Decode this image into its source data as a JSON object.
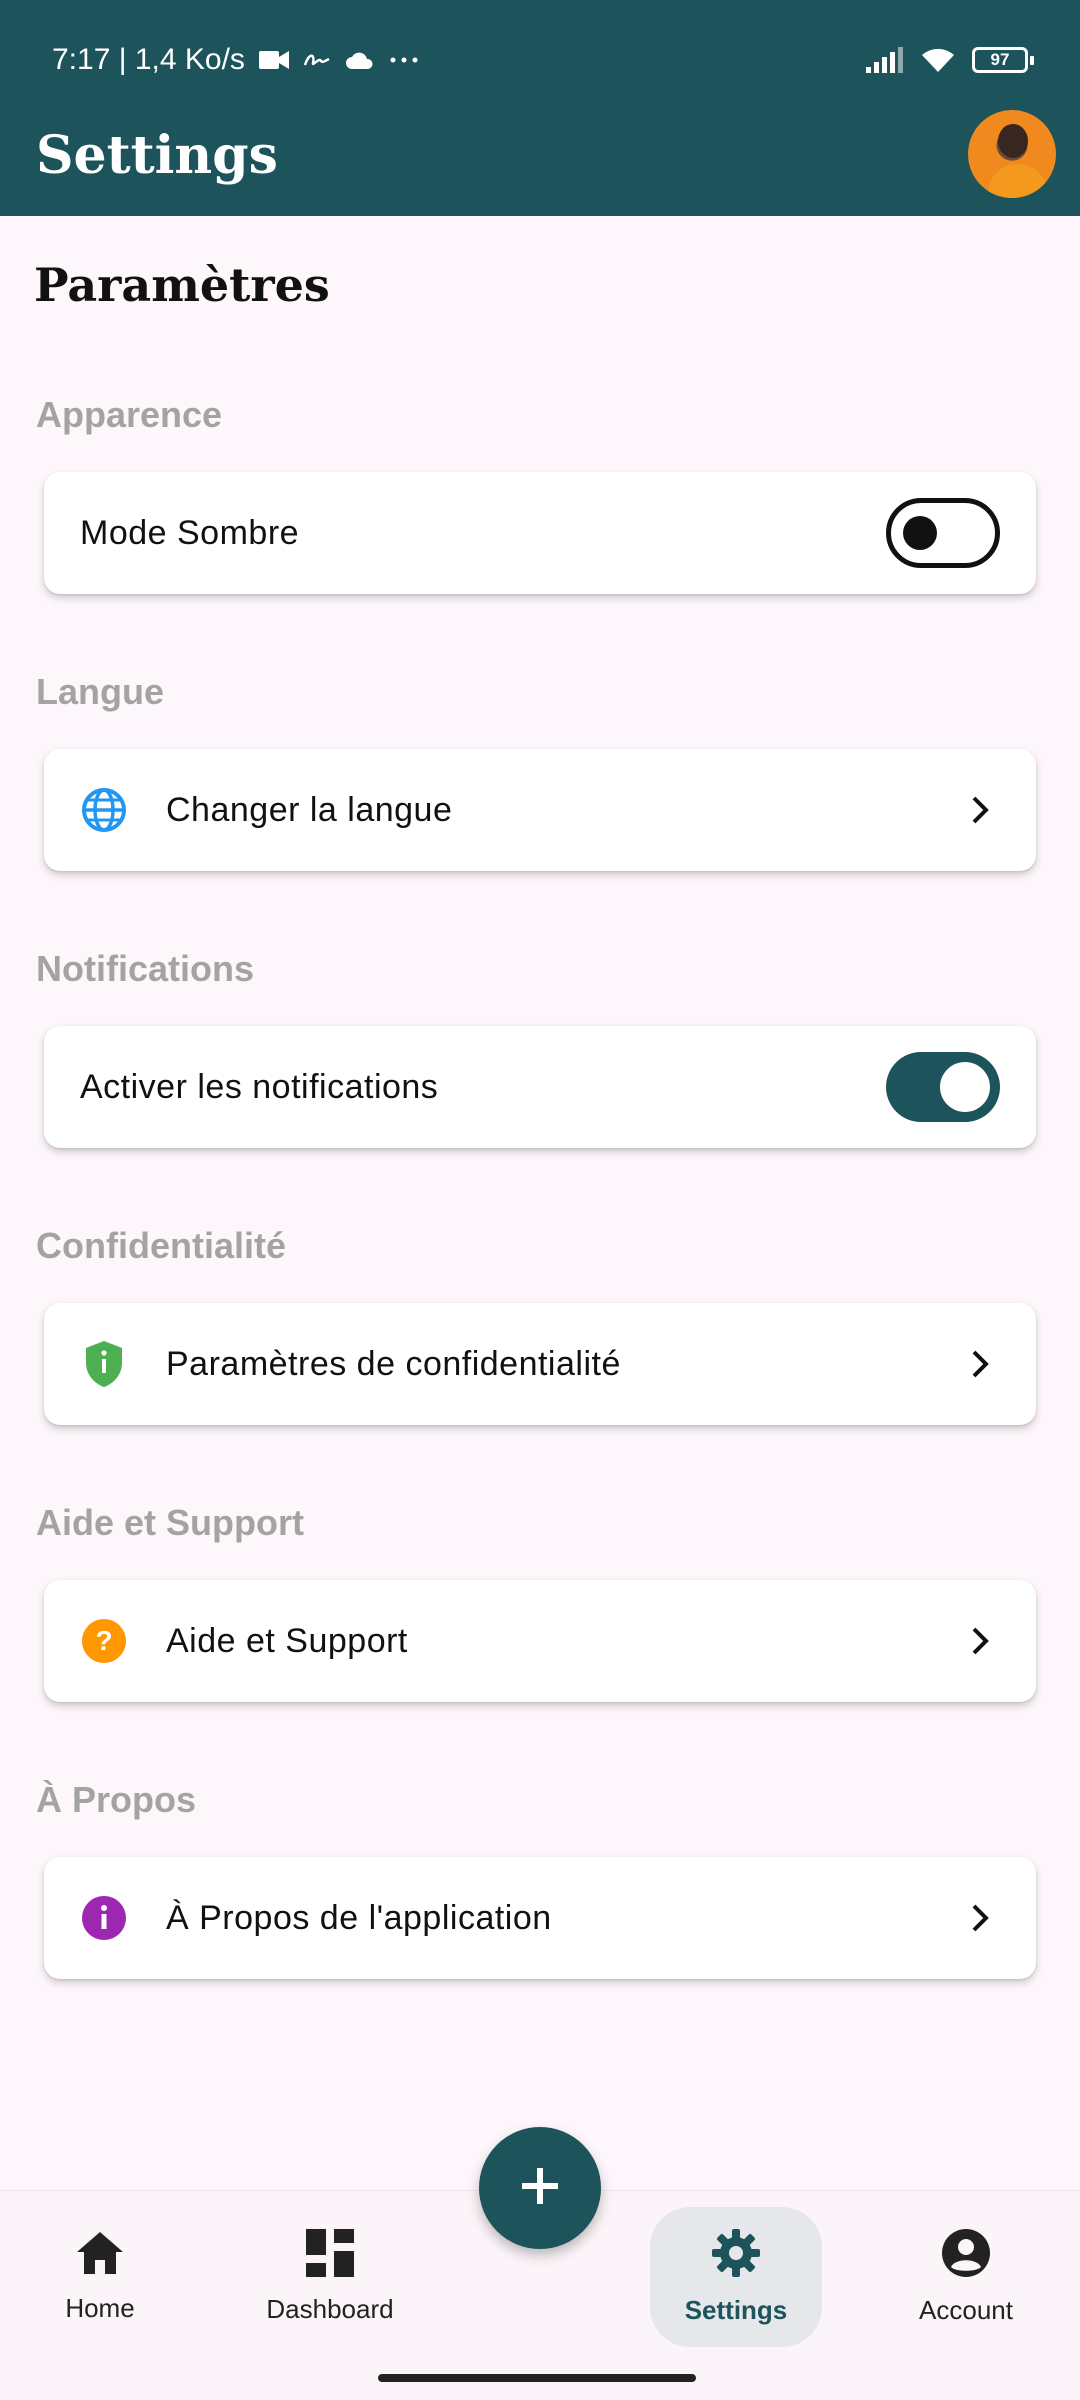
{
  "status_bar": {
    "time_info": "7:17 | 1,4 Ko/s",
    "battery": "97"
  },
  "app_bar": {
    "title": "Settings"
  },
  "page": {
    "heading": "Paramètres"
  },
  "sections": {
    "appearance": {
      "label": "Apparence",
      "item": "Mode Sombre",
      "toggle_on": false
    },
    "language": {
      "label": "Langue",
      "item": "Changer la langue"
    },
    "notifications": {
      "label": "Notifications",
      "item": "Activer les notifications",
      "toggle_on": true
    },
    "privacy": {
      "label": "Confidentialité",
      "item": "Paramètres de confidentialité"
    },
    "help": {
      "label": "Aide et Support",
      "item": "Aide et Support"
    },
    "about": {
      "label": "À Propos",
      "item": "À Propos de l'application"
    }
  },
  "bottom_nav": {
    "items": [
      {
        "label": "Home",
        "icon": "home-icon"
      },
      {
        "label": "Dashboard",
        "icon": "dashboard-icon"
      },
      {
        "label": "Settings",
        "icon": "gear-icon",
        "active": true
      },
      {
        "label": "Account",
        "icon": "account-circle-icon"
      }
    ]
  },
  "colors": {
    "primary": "#1d545b",
    "background": "#fdf6fb",
    "section_label": "#a3a3a3",
    "globe_icon": "#2196f3",
    "shield_icon": "#4caf50",
    "help_icon": "#ff9800",
    "info_icon": "#9c27b0"
  }
}
